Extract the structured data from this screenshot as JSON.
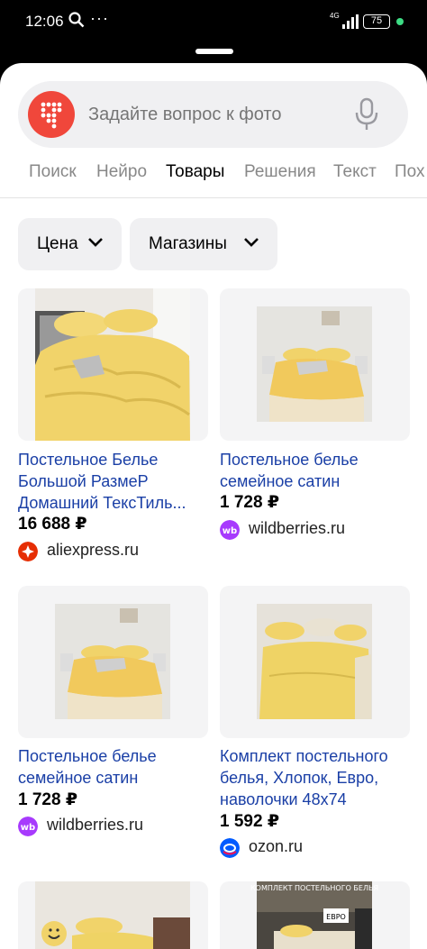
{
  "status_bar": {
    "time": "12:06",
    "network": "4G",
    "battery": "75"
  },
  "search": {
    "placeholder": "Задайте вопрос к фото"
  },
  "tabs": [
    {
      "label": "Поиск",
      "active": false
    },
    {
      "label": "Нейро",
      "active": false
    },
    {
      "label": "Товары",
      "active": true
    },
    {
      "label": "Решения",
      "active": false
    },
    {
      "label": "Текст",
      "active": false
    },
    {
      "label": "Пох",
      "active": false
    }
  ],
  "filters": [
    {
      "label": "Цена"
    },
    {
      "label": "Магазины"
    }
  ],
  "products": [
    {
      "title": "Постельное Белье Большой РазмеР Домашний ТексТиль...",
      "price": "16 688 ₽",
      "shop": "aliexpress.ru",
      "shop_color": "#e62e04"
    },
    {
      "title": "Постельное белье семейное сатин",
      "price": "1 728 ₽",
      "shop": "wildberries.ru",
      "shop_color": "#a73afd"
    },
    {
      "title": "Постельное белье семейное сатин",
      "price": "1 728 ₽",
      "shop": "wildberries.ru",
      "shop_color": "#a73afd"
    },
    {
      "title": "Комплект постельного белья, Хлопок, Евро, наволочки 48х74",
      "price": "1 592 ₽",
      "shop": "ozon.ru",
      "shop_color": "#005bff"
    },
    {
      "title": "",
      "price": "",
      "shop": "",
      "image_text": "КОМПЛЕКТ ПОСТЕЛЬНОГО БЕЛЬЯ",
      "badge": "ЕВРО"
    }
  ],
  "colors": {
    "accent_link": "#1a3fa6",
    "bedding_yellow": "#f1d36a",
    "logo_red": "#f0473b"
  }
}
